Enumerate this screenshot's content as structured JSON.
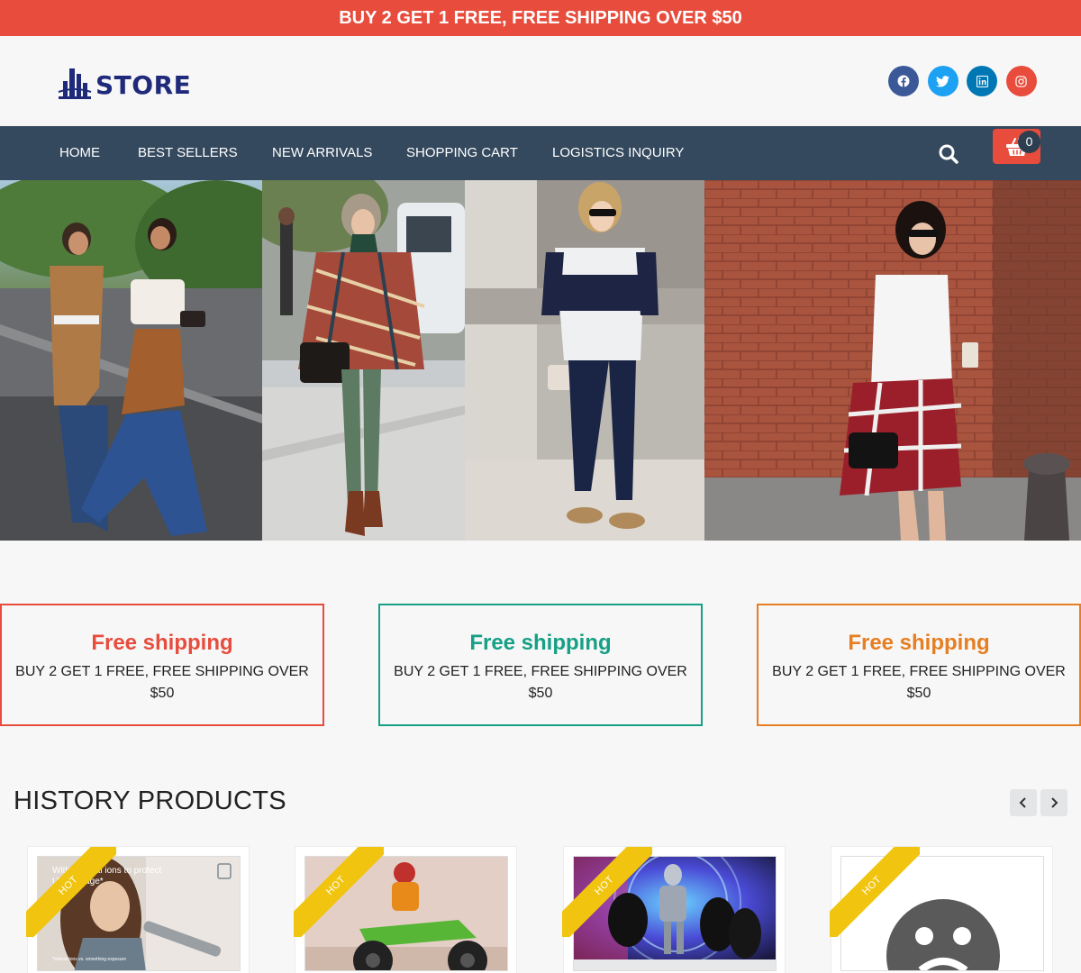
{
  "promo_bar": {
    "text": "BUY 2 GET 1 FREE, FREE SHIPPING OVER $50"
  },
  "header": {
    "logo_text": "STORE",
    "socials": [
      {
        "name": "facebook",
        "color": "#3b5998"
      },
      {
        "name": "twitter",
        "color": "#1da1f2"
      },
      {
        "name": "linkedin",
        "color": "#0077b5"
      },
      {
        "name": "instagram",
        "color": "#e74c3c"
      }
    ]
  },
  "nav": {
    "items": [
      "HOME",
      "BEST SELLERS",
      "NEW ARRIVALS",
      "SHOPPING CART",
      "LOGISTICS INQUIRY"
    ],
    "cart_count": "0"
  },
  "features": [
    {
      "title": "Free shipping",
      "text": "BUY 2 GET 1 FREE, FREE SHIPPING OVER $50",
      "color": "#e74c3c"
    },
    {
      "title": "Free shipping",
      "text": "BUY 2 GET 1 FREE, FREE SHIPPING OVER $50",
      "color": "#16a085"
    },
    {
      "title": "Free shipping",
      "text": "BUY 2 GET 1 FREE, FREE SHIPPING OVER $50",
      "color": "#e67e22"
    }
  ],
  "history": {
    "title": "HISTORY PRODUCTS",
    "badge": "HOT",
    "card1_caption": "With mineral ions to protect UV damage*",
    "card1_footnote": "*Interactions vs. smoothing exposure"
  }
}
